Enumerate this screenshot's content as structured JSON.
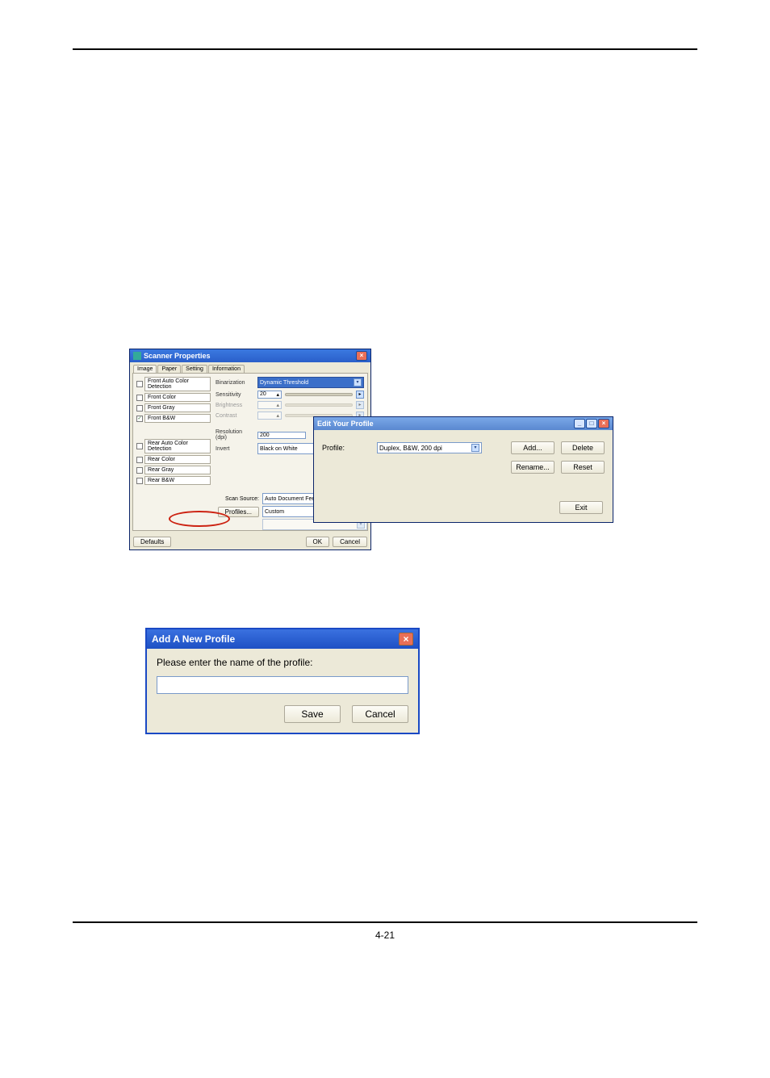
{
  "scanner": {
    "title": "Scanner Properties",
    "tabs": [
      "Image",
      "Paper",
      "Setting",
      "Information"
    ],
    "selection": {
      "front": [
        {
          "label": "Front Auto Color Detection",
          "checked": false
        },
        {
          "label": "Front Color",
          "checked": false
        },
        {
          "label": "Front Gray",
          "checked": false
        },
        {
          "label": "Front B&W",
          "checked": true
        }
      ],
      "rear": [
        {
          "label": "Rear Auto Color Detection",
          "checked": false
        },
        {
          "label": "Rear Color",
          "checked": false
        },
        {
          "label": "Rear Gray",
          "checked": false
        },
        {
          "label": "Rear B&W",
          "checked": false
        }
      ]
    },
    "props": {
      "binarization_label": "Binarization",
      "binarization_value": "Dynamic Threshold",
      "sensitivity_label": "Sensitivity",
      "sensitivity_value": "20",
      "brightness_label": "Brightness",
      "contrast_label": "Contrast",
      "resolution_label": "Resolution (dpi)",
      "resolution_value": "200",
      "invert_label": "Invert",
      "invert_value": "Black on White"
    },
    "bottom": {
      "scan_source_label": "Scan Source:",
      "scan_source_value": "Auto Document Feeder",
      "profiles_btn": "Profiles...",
      "profiles_value": "Custom",
      "defaults_btn": "Defaults",
      "ok_btn": "OK",
      "cancel_btn": "Cancel"
    }
  },
  "edit_profile": {
    "title": "Edit Your Profile",
    "profile_label": "Profile:",
    "profile_value": "Duplex, B&W, 200 dpi",
    "add_btn": "Add...",
    "delete_btn": "Delete",
    "rename_btn": "Rename...",
    "reset_btn": "Reset",
    "exit_btn": "Exit"
  },
  "add_profile": {
    "title": "Add A New Profile",
    "prompt": "Please enter the name of the profile:",
    "save_btn": "Save",
    "cancel_btn": "Cancel"
  },
  "page_number": "4-21"
}
